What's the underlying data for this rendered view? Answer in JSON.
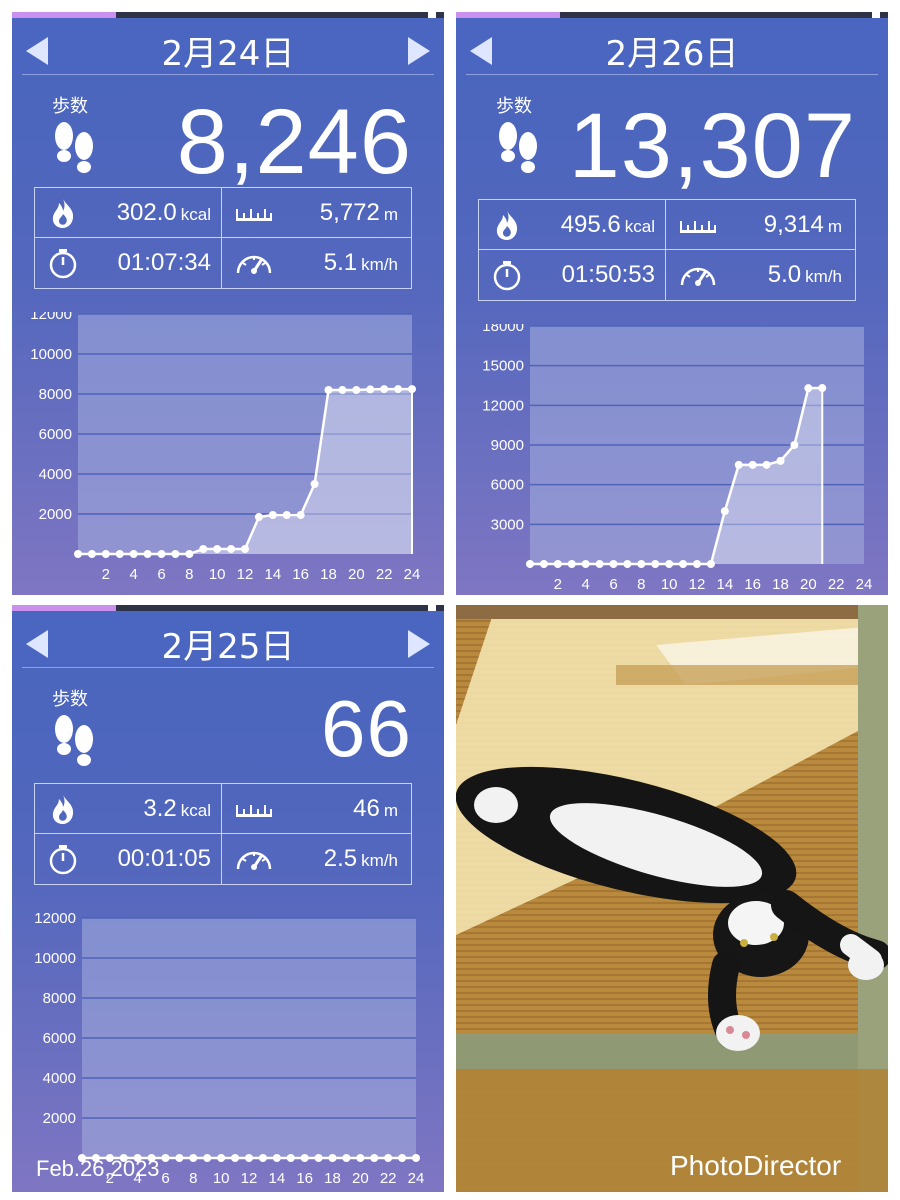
{
  "panels": [
    {
      "date": "2月24日",
      "steps_label": "歩数",
      "steps": "8,246",
      "calories": "302.0",
      "calories_unit": "kcal",
      "distance": "5,772",
      "distance_unit": "m",
      "duration": "01:07:34",
      "speed": "5.1",
      "speed_unit": "km/h",
      "chart_data": {
        "type": "area",
        "x": [
          0,
          1,
          2,
          3,
          4,
          5,
          6,
          7,
          8,
          9,
          10,
          11,
          12,
          13,
          14,
          15,
          16,
          17,
          18,
          19,
          20,
          21,
          22,
          23,
          24
        ],
        "values": [
          0,
          0,
          0,
          0,
          0,
          0,
          0,
          0,
          0,
          250,
          250,
          250,
          250,
          1850,
          1950,
          1950,
          1950,
          3500,
          8200,
          8200,
          8200,
          8230,
          8246,
          8246,
          8246
        ],
        "ylim": [
          0,
          12000
        ],
        "yticks": [
          "12000",
          "10000",
          "8000",
          "6000",
          "4000",
          "2000"
        ],
        "xticks": [
          "2",
          "4",
          "6",
          "8",
          "10",
          "12",
          "14",
          "16",
          "18",
          "20",
          "22",
          "24"
        ],
        "grid": true
      }
    },
    {
      "date": "2月26日",
      "steps_label": "歩数",
      "steps": "13,307",
      "calories": "495.6",
      "calories_unit": "kcal",
      "distance": "9,314",
      "distance_unit": "m",
      "duration": "01:50:53",
      "speed": "5.0",
      "speed_unit": "km/h",
      "chart_data": {
        "type": "area",
        "x": [
          0,
          1,
          2,
          3,
          4,
          5,
          6,
          7,
          8,
          9,
          10,
          11,
          12,
          13,
          14,
          15,
          16,
          17,
          18,
          19,
          20,
          21
        ],
        "values": [
          0,
          0,
          0,
          0,
          0,
          0,
          0,
          0,
          0,
          0,
          0,
          0,
          0,
          0,
          4000,
          7500,
          7500,
          7500,
          7800,
          9000,
          13300,
          13307
        ],
        "ylim": [
          0,
          18000
        ],
        "yticks": [
          "18000",
          "15000",
          "12000",
          "9000",
          "6000",
          "3000"
        ],
        "xticks": [
          "2",
          "4",
          "6",
          "8",
          "10",
          "12",
          "14",
          "16",
          "18",
          "20",
          "22",
          "24"
        ],
        "grid": true
      }
    },
    {
      "date": "2月25日",
      "steps_label": "歩数",
      "steps": "66",
      "calories": "3.2",
      "calories_unit": "kcal",
      "distance": "46",
      "distance_unit": "m",
      "duration": "00:01:05",
      "speed": "2.5",
      "speed_unit": "km/h",
      "chart_data": {
        "type": "area",
        "x": [
          0,
          1,
          2,
          3,
          4,
          5,
          6,
          7,
          8,
          9,
          10,
          11,
          12,
          13,
          14,
          15,
          16,
          17,
          18,
          19,
          20,
          21,
          22,
          23,
          24
        ],
        "values": [
          0,
          0,
          0,
          0,
          0,
          0,
          0,
          0,
          0,
          0,
          0,
          0,
          0,
          0,
          0,
          0,
          0,
          0,
          0,
          0,
          0,
          0,
          0,
          0,
          0
        ],
        "ylim": [
          0,
          12000
        ],
        "yticks": [
          "12000",
          "10000",
          "8000",
          "6000",
          "4000",
          "2000"
        ],
        "xticks": [
          "2",
          "4",
          "6",
          "8",
          "10",
          "12",
          "14",
          "16",
          "18",
          "20",
          "22",
          "24"
        ],
        "grid": true
      }
    }
  ],
  "footer": {
    "date_stamp": "Feb.26,2023",
    "watermark": "PhotoDirector"
  },
  "colors": {
    "panel_bg": "#4a66c1",
    "progress": "#c990ee",
    "chart_area": "#a9b3e0"
  },
  "icons": [
    "footprints-icon",
    "flame-icon",
    "ruler-icon",
    "stopwatch-icon",
    "speedometer-icon",
    "chevron-left-icon",
    "chevron-right-icon"
  ]
}
